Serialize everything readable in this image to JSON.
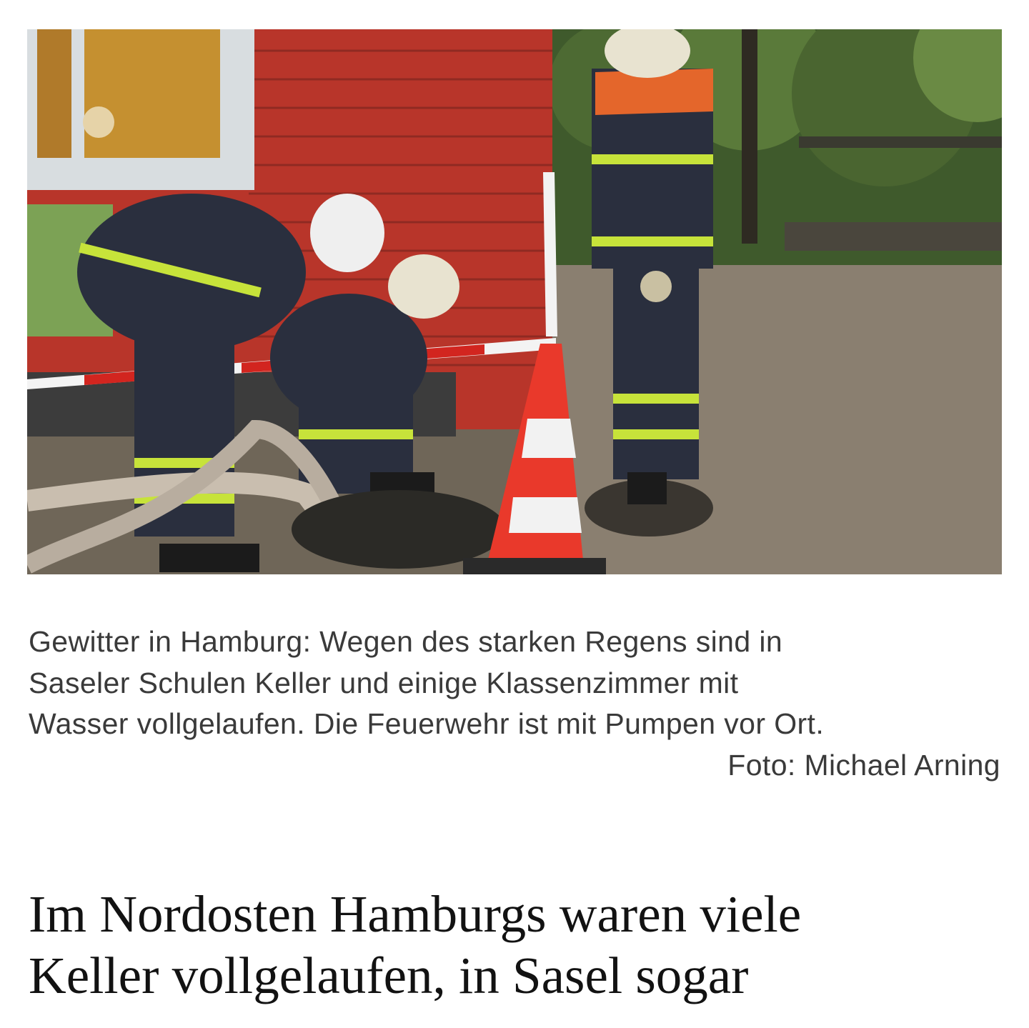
{
  "article": {
    "photo": {
      "description_icon": "firefighters-pumping-photo"
    },
    "caption": {
      "lines": [
        "Gewitter in Hamburg: Wegen des starken Regens sind in",
        "Saseler Schulen Keller und einige Klassenzimmer mit",
        "Wasser vollgelaufen. Die Feuerwehr ist mit Pumpen vor Ort."
      ],
      "credit": "Foto: Michael Arning"
    },
    "headline": {
      "lines": [
        "Im Nordosten Hamburgs waren viele",
        "Keller vollgelaufen, in Sasel sogar"
      ]
    }
  }
}
